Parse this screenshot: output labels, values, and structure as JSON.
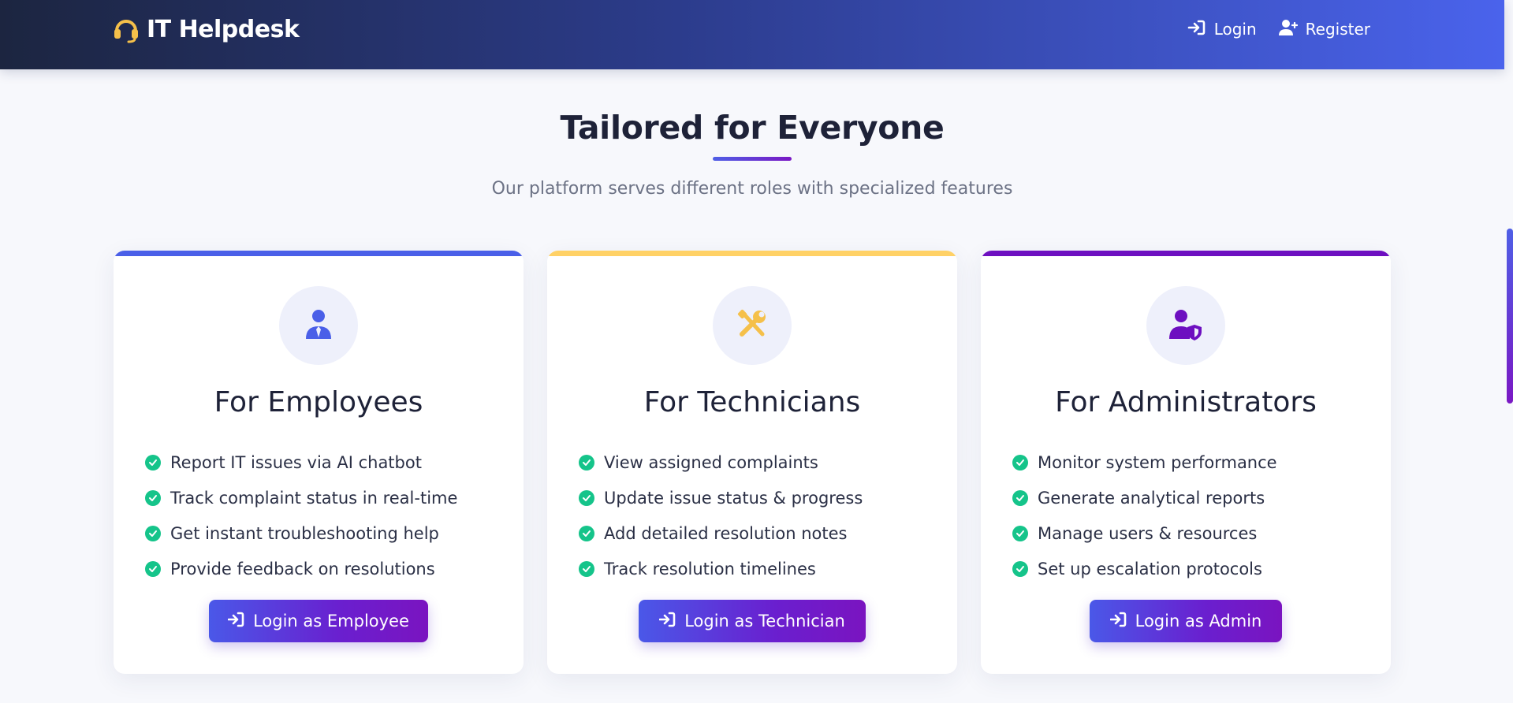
{
  "navbar": {
    "brand": "IT Helpdesk",
    "brand_icon": "headset-icon",
    "links": [
      {
        "label": "Login",
        "icon": "sign-in-icon"
      },
      {
        "label": "Register",
        "icon": "user-plus-icon"
      }
    ]
  },
  "section": {
    "title": "Tailored for Everyone",
    "subtitle": "Our platform serves different roles with specialized features"
  },
  "cards": [
    {
      "title": "For Employees",
      "icon": "employee-icon",
      "accent": "#4a5fe8",
      "features": [
        "Report IT issues via AI chatbot",
        "Track complaint status in real-time",
        "Get instant troubleshooting help",
        "Provide feedback on resolutions"
      ],
      "button": "Login as Employee"
    },
    {
      "title": "For Technicians",
      "icon": "tools-icon",
      "accent": "#ffd166",
      "features": [
        "View assigned complaints",
        "Update issue status & progress",
        "Add detailed resolution notes",
        "Track resolution timelines"
      ],
      "button": "Login as Technician"
    },
    {
      "title": "For Administrators",
      "icon": "user-shield-icon",
      "accent": "#6d0fc0",
      "features": [
        "Monitor system performance",
        "Generate analytical reports",
        "Manage users & resources",
        "Set up escalation protocols"
      ],
      "button": "Login as Admin"
    }
  ],
  "colors": {
    "check": "#15c48a",
    "heading": "#1e2238",
    "subtitle": "#6c7285",
    "button_gradient_start": "#4a58e8",
    "button_gradient_end": "#7a14c0"
  }
}
